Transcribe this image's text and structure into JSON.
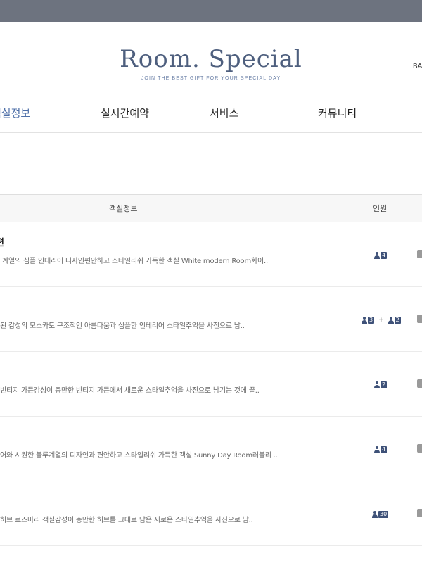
{
  "brand": {
    "title": "Room. Special",
    "tagline": "JOIN THE BEST GIFT FOR YOUR SPECIAL DAY",
    "corner_text": "BA"
  },
  "nav": [
    {
      "label": "객실정보",
      "active": true
    },
    {
      "label": "실시간예약",
      "active": false
    },
    {
      "label": "서비스",
      "active": false
    },
    {
      "label": "커뮤니티",
      "active": false
    }
  ],
  "table": {
    "headers": {
      "room_info": "객실정보",
      "capacity": "인원"
    },
    "rows": [
      {
        "title": "편",
        "description": "계열의 심플 인테리어 디자인편안하고 스타일리쉬 가득한 객실 White modern Room화이..",
        "capacity": [
          {
            "icon": "person-icon",
            "count": "4"
          }
        ]
      },
      {
        "title": "",
        "description": "된 감성의 모스카토 구조적인 아름다움과 심플한 인테리어 스타일추억을 사진으로 남..",
        "capacity": [
          {
            "icon": "person-icon",
            "count": "3"
          },
          {
            "icon": "person-icon",
            "count": "2"
          }
        ],
        "plus": "+"
      },
      {
        "title": "",
        "description": "빈티지 가든감성이 충만한 빈티지 가든에서 새로운 스타일추억을 사진으로 남기는 것에 끝..",
        "capacity": [
          {
            "icon": "person-icon",
            "count": "2"
          }
        ]
      },
      {
        "title": "",
        "description": "어와 시원한 블루계열의 디자인과 편안하고 스타일리쉬 가득한 객실 Sunny Day Room러블리 ..",
        "capacity": [
          {
            "icon": "person-icon",
            "count": "4"
          }
        ]
      },
      {
        "title": "",
        "description": "허브 로즈마리 객실감성이 충만한 허브를 그대로 담은 새로운 스타일추억을 사진으로 남..",
        "capacity": [
          {
            "icon": "person-icon",
            "count": "30"
          }
        ]
      }
    ]
  },
  "colors": {
    "topbar": "#6d737f",
    "brand": "#4e5f7e",
    "active_nav": "#4e6fa8",
    "badge": "#3e5178"
  }
}
